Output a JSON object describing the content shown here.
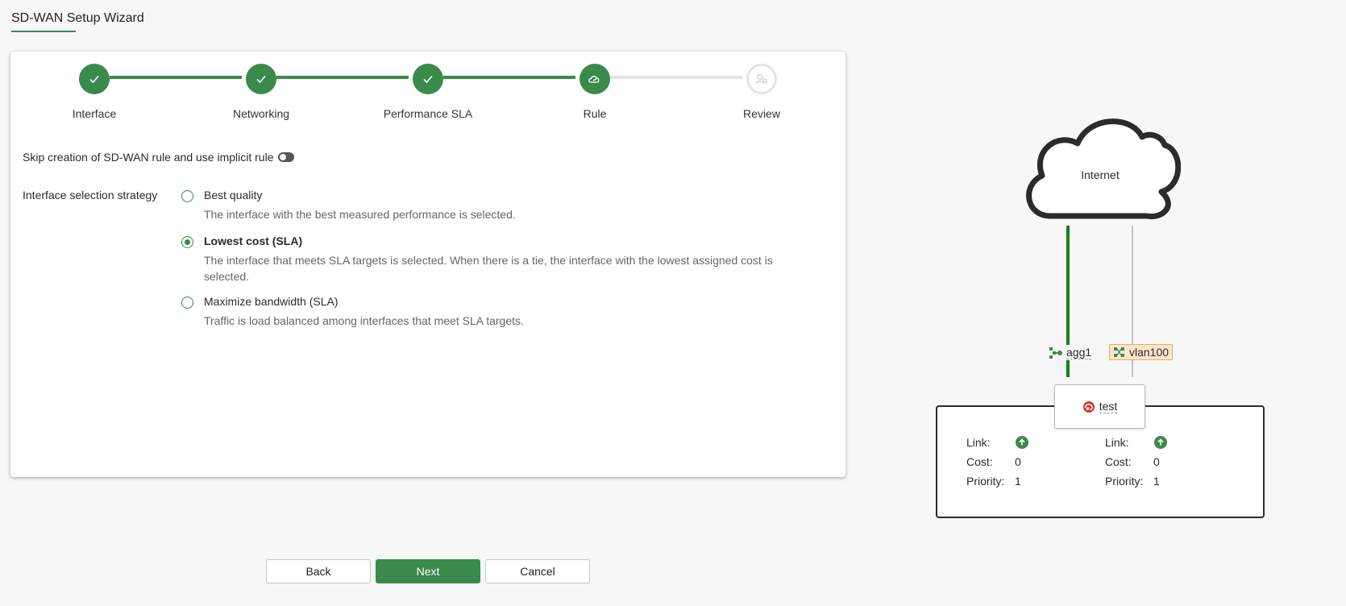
{
  "page": {
    "title": "SD-WAN Setup Wizard",
    "accent_color": "#3a8a4c"
  },
  "stepper": {
    "steps": [
      {
        "label": "Interface",
        "state": "completed",
        "icon": "check-icon"
      },
      {
        "label": "Networking",
        "state": "completed",
        "icon": "check-icon"
      },
      {
        "label": "Performance SLA",
        "state": "completed",
        "icon": "check-icon"
      },
      {
        "label": "Rule",
        "state": "current",
        "icon": "rule-icon"
      },
      {
        "label": "Review",
        "state": "pending",
        "icon": "review-icon"
      }
    ]
  },
  "form": {
    "skip_label": "Skip creation of SD-WAN rule and use implicit rule",
    "skip_enabled": false,
    "strategy_label": "Interface selection strategy",
    "options": [
      {
        "title": "Best quality",
        "desc": "The interface with the best measured performance is selected.",
        "selected": false
      },
      {
        "title": "Lowest cost (SLA)",
        "desc": "The interface that meets SLA targets is selected. When there is a tie, the interface with the lowest assigned cost is selected.",
        "selected": true
      },
      {
        "title": "Maximize bandwidth (SLA)",
        "desc": "Traffic is load balanced among interfaces that meet SLA targets.",
        "selected": false
      }
    ]
  },
  "buttons": {
    "back": "Back",
    "next": "Next",
    "cancel": "Cancel"
  },
  "diagram": {
    "cloud_label": "Internet",
    "interfaces": [
      {
        "name": "agg1",
        "icon": "aggregate-icon",
        "active": true
      },
      {
        "name": "vlan100",
        "icon": "vlan-icon",
        "active": false
      }
    ],
    "zone": {
      "name": "test",
      "icon": "sdwan-zone-icon"
    },
    "stats": [
      {
        "link_label": "Link:",
        "link_status": "up",
        "cost_label": "Cost:",
        "cost": "0",
        "priority_label": "Priority:",
        "priority": "1"
      },
      {
        "link_label": "Link:",
        "link_status": "up",
        "cost_label": "Cost:",
        "cost": "0",
        "priority_label": "Priority:",
        "priority": "1"
      }
    ]
  }
}
